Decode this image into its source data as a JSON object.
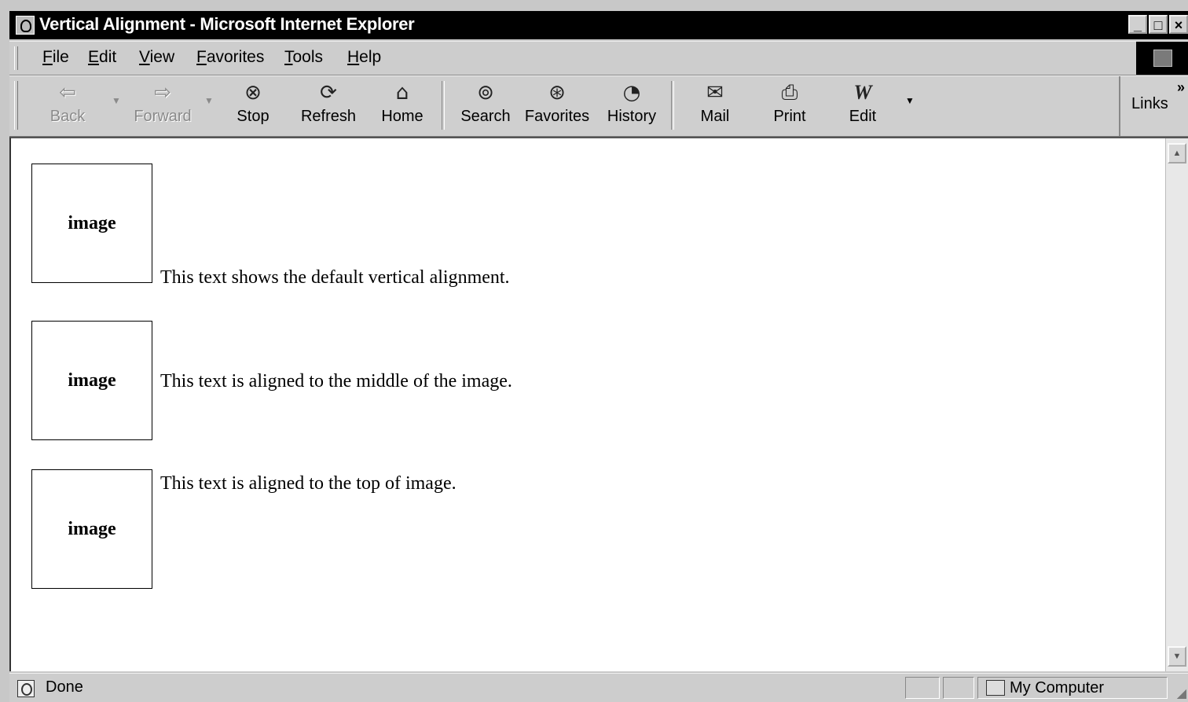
{
  "window": {
    "title": "Vertical Alignment - Microsoft Internet Explorer",
    "controls": {
      "minimize": "_",
      "maximize": "□",
      "close": "×"
    }
  },
  "menubar": {
    "items": [
      {
        "label": "File"
      },
      {
        "label": "Edit"
      },
      {
        "label": "View"
      },
      {
        "label": "Favorites"
      },
      {
        "label": "Tools"
      },
      {
        "label": "Help"
      }
    ]
  },
  "toolbar": {
    "buttons": [
      {
        "label": "Back",
        "icon": "back-arrow-icon",
        "glyph": "⇦",
        "enabled": false
      },
      {
        "label": "Forward",
        "icon": "forward-arrow-icon",
        "glyph": "⇨",
        "enabled": false
      },
      {
        "label": "Stop",
        "icon": "stop-icon",
        "glyph": "⊗",
        "enabled": true
      },
      {
        "label": "Refresh",
        "icon": "refresh-icon",
        "glyph": "⟳",
        "enabled": true
      },
      {
        "label": "Home",
        "icon": "home-icon",
        "glyph": "⌂",
        "enabled": true
      },
      {
        "label": "Search",
        "icon": "search-icon",
        "glyph": "⊚",
        "enabled": true
      },
      {
        "label": "Favorites",
        "icon": "favorites-icon",
        "glyph": "⊛",
        "enabled": true
      },
      {
        "label": "History",
        "icon": "history-icon",
        "glyph": "◔",
        "enabled": true
      },
      {
        "label": "Mail",
        "icon": "mail-icon",
        "glyph": "✉",
        "enabled": true
      },
      {
        "label": "Print",
        "icon": "print-icon",
        "glyph": "⎙",
        "enabled": true
      },
      {
        "label": "Edit",
        "icon": "edit-icon",
        "glyph": "W",
        "enabled": true
      }
    ],
    "links_label": "Links",
    "chevron": "»"
  },
  "content": {
    "rows": [
      {
        "image_label": "image",
        "text": "This text shows the default vertical alignment.",
        "alignment": "baseline"
      },
      {
        "image_label": "image",
        "text": "This text is aligned to the middle of the image.",
        "alignment": "middle"
      },
      {
        "image_label": "image",
        "text": "This text is aligned to the top of image.",
        "alignment": "top"
      }
    ]
  },
  "statusbar": {
    "status_text": "Done",
    "zone_text": "My Computer"
  }
}
